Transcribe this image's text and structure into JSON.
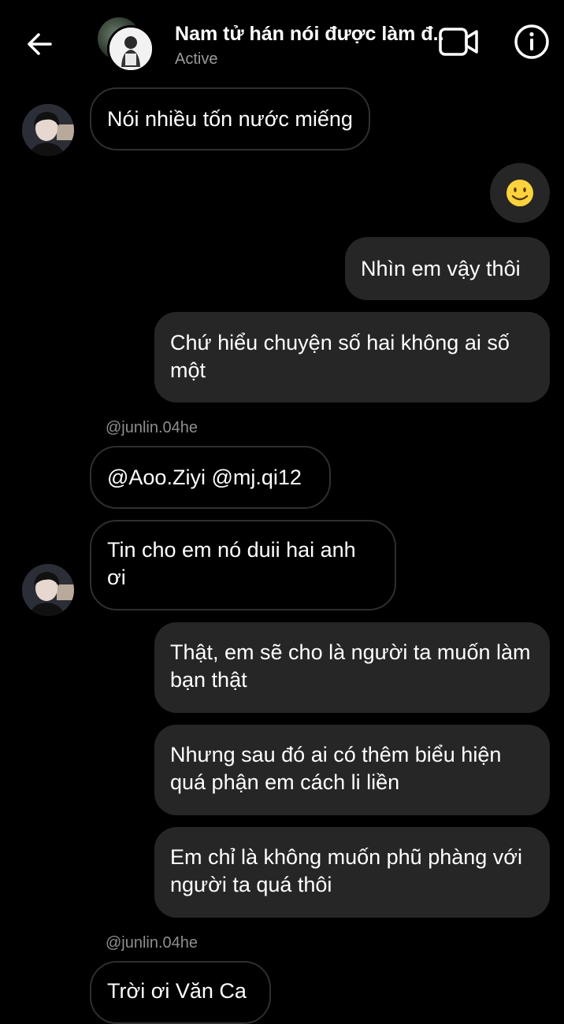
{
  "header": {
    "title": "Nam tử hán nói được làm đ...",
    "status": "Active"
  },
  "messages": {
    "m1": "Nói nhiều tốn nước miếng",
    "m3": "Nhìn em vậy thôi",
    "m4": "Chứ hiểu chuyện số hai không ai số một",
    "handle1": "@junlin.04he",
    "m5": "@Aoo.Ziyi @mj.qi12",
    "m6": "Tin cho em nó duii hai anh ơi",
    "m7": "Thật, em sẽ cho là người ta muốn làm bạn thật",
    "m8": "Nhưng sau đó ai có thêm biểu hiện quá phận em cách li liền",
    "m9": "Em chỉ là không muốn phũ phàng với người ta quá thôi",
    "handle2": "@junlin.04he",
    "m10": "Trời ơi Văn Ca"
  },
  "icons": {
    "back": "arrow-left-icon",
    "video": "video-camera-icon",
    "info": "info-icon",
    "emoji": "slightly-smiling-face-emoji"
  },
  "colors": {
    "background": "#000000",
    "outgoing_bubble": "#262626",
    "incoming_border": "#2f2f2f",
    "secondary_text": "#8e8e8e"
  }
}
